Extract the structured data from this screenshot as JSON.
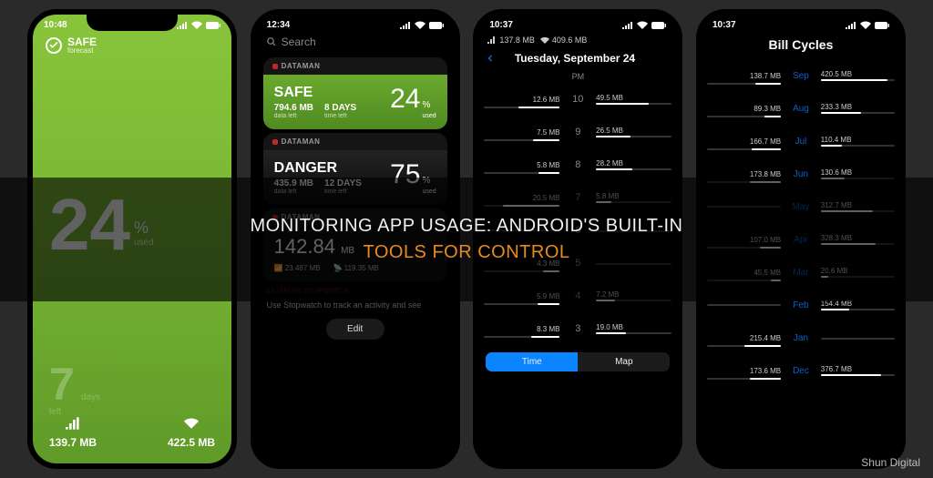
{
  "overlay": {
    "line1": "MONITORING APP USAGE: ANDROID'S BUILT-IN",
    "line2": "TOOLS FOR CONTROL"
  },
  "watermark": "Shun Digital",
  "p1": {
    "time": "10:48",
    "safe_label": "SAFE",
    "safe_sub": "forecast",
    "main_num": "24",
    "pct_sym": "%",
    "used_lbl": "used",
    "ghost_num": "7",
    "ghost_unit": "days",
    "ghost_lbl": "left",
    "cell_val": "139.7 MB",
    "wifi_val": "422.5 MB"
  },
  "p2": {
    "time": "12:34",
    "search_ph": "Search",
    "brand": "DATAMAN",
    "safe": {
      "title": "SAFE",
      "data": "794.6 MB",
      "data_l": "data left",
      "days": "8 DAYS",
      "days_l": "time left",
      "pct": "24",
      "pct_l": "used"
    },
    "danger": {
      "title": "DANGER",
      "data": "435.9 MB",
      "data_l": "data left",
      "days": "12 DAYS",
      "days_l": "time left",
      "pct": "75",
      "pct_l": "used"
    },
    "sum": {
      "val": "142.84",
      "unit": "MB",
      "cell": "23.487 MB",
      "wifi": "119.35 MB"
    },
    "hint_hdr": "DATAMAN STOPWATCH",
    "hint_txt": "Use Stopwatch to track an activity and see",
    "edit": "Edit"
  },
  "p3": {
    "time": "10:37",
    "cell": "137.8 MB",
    "wifi": "409.6 MB",
    "title": "Tuesday, September 24",
    "pm": "PM",
    "rows": [
      {
        "l": "12.6 MB",
        "lw": 55,
        "h": "10",
        "r": "49.5 MB",
        "rw": 70
      },
      {
        "l": "7.5 MB",
        "lw": 35,
        "h": "9",
        "r": "26.5 MB",
        "rw": 45
      },
      {
        "l": "5.8 MB",
        "lw": 28,
        "h": "8",
        "r": "28.2 MB",
        "rw": 48
      },
      {
        "l": "20.5 MB",
        "lw": 75,
        "h": "7",
        "r": "5.8 MB",
        "rw": 20
      },
      {
        "l": "",
        "lw": 0,
        "h": "6",
        "r": "",
        "rw": 0
      },
      {
        "l": "4.3 MB",
        "lw": 22,
        "h": "5",
        "r": "",
        "rw": 0
      },
      {
        "l": "5.9 MB",
        "lw": 30,
        "h": "4",
        "r": "7.2 MB",
        "rw": 25
      },
      {
        "l": "8.3 MB",
        "lw": 38,
        "h": "3",
        "r": "19.0 MB",
        "rw": 40
      }
    ],
    "seg_time": "Time",
    "seg_map": "Map"
  },
  "p4": {
    "time": "10:37",
    "title": "Bill Cycles",
    "rows": [
      {
        "l": "138.7 MB",
        "lw": 35,
        "m": "Sep",
        "r": "420.5 MB",
        "rw": 90
      },
      {
        "l": "89.3 MB",
        "lw": 22,
        "m": "Aug",
        "r": "233.3 MB",
        "rw": 55
      },
      {
        "l": "166.7 MB",
        "lw": 40,
        "m": "Jul",
        "r": "110.4 MB",
        "rw": 28
      },
      {
        "l": "173.8 MB",
        "lw": 42,
        "m": "Jun",
        "r": "130.6 MB",
        "rw": 32
      },
      {
        "l": "",
        "lw": 0,
        "m": "May",
        "r": "312.7 MB",
        "rw": 70
      },
      {
        "l": "107.0 MB",
        "lw": 28,
        "m": "Apr",
        "r": "328.3 MB",
        "rw": 74
      },
      {
        "l": "45.5 MB",
        "lw": 14,
        "m": "Mar",
        "r": "20.6 MB",
        "rw": 10
      },
      {
        "l": "",
        "lw": 0,
        "m": "Feb",
        "r": "154.4 MB",
        "rw": 38
      },
      {
        "l": "215.4 MB",
        "lw": 50,
        "m": "Jan",
        "r": "",
        "rw": 0
      },
      {
        "l": "173.6 MB",
        "lw": 42,
        "m": "Dec",
        "r": "376.7 MB",
        "rw": 82
      }
    ]
  }
}
